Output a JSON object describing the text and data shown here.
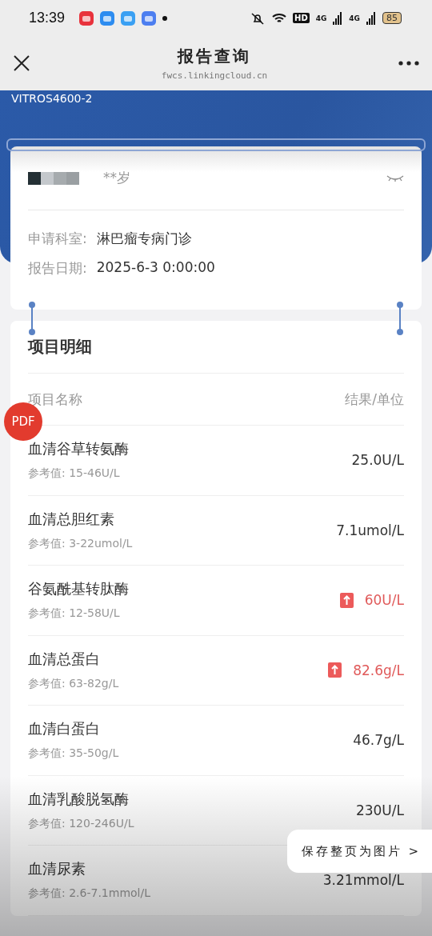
{
  "status_bar": {
    "time": "13:39",
    "hd": "HD",
    "networks": [
      "4G",
      "4G"
    ],
    "battery": "85"
  },
  "header": {
    "title": "报告查询",
    "subtitle": "fwcs.linkingcloud.cn"
  },
  "hero": {
    "instrument": "VITROS4600-2"
  },
  "patient": {
    "age": "**岁",
    "info": [
      {
        "label": "申请科室:",
        "value": "淋巴瘤专病门诊"
      },
      {
        "label": "报告日期:",
        "value": "2025-6-3 0:00:00"
      }
    ]
  },
  "details": {
    "title": "项目明细",
    "columns": [
      "项目名称",
      "结果/单位"
    ],
    "rows": [
      {
        "name": "血清谷草转氨酶",
        "reference": "参考值: 15-46U/L",
        "value": "25.0U/L",
        "high": false
      },
      {
        "name": "血清总胆红素",
        "reference": "参考值: 3-22umol/L",
        "value": "7.1umol/L",
        "high": false
      },
      {
        "name": "谷氨酰基转肽酶",
        "reference": "参考值: 12-58U/L",
        "value": "60U/L",
        "high": true
      },
      {
        "name": "血清总蛋白",
        "reference": "参考值: 63-82g/L",
        "value": "82.6g/L",
        "high": true
      },
      {
        "name": "血清白蛋白",
        "reference": "参考值: 35-50g/L",
        "value": "46.7g/L",
        "high": false
      },
      {
        "name": "血清乳酸脱氢酶",
        "reference": "参考值: 120-246U/L",
        "value": "230U/L",
        "high": false
      },
      {
        "name": "血清尿素",
        "reference": "参考值: 2.6-7.1mmol/L",
        "value": "3.21mmol/L",
        "high": false
      }
    ]
  },
  "pdf_badge": "PDF",
  "save_button": "保存整页为图片 >"
}
